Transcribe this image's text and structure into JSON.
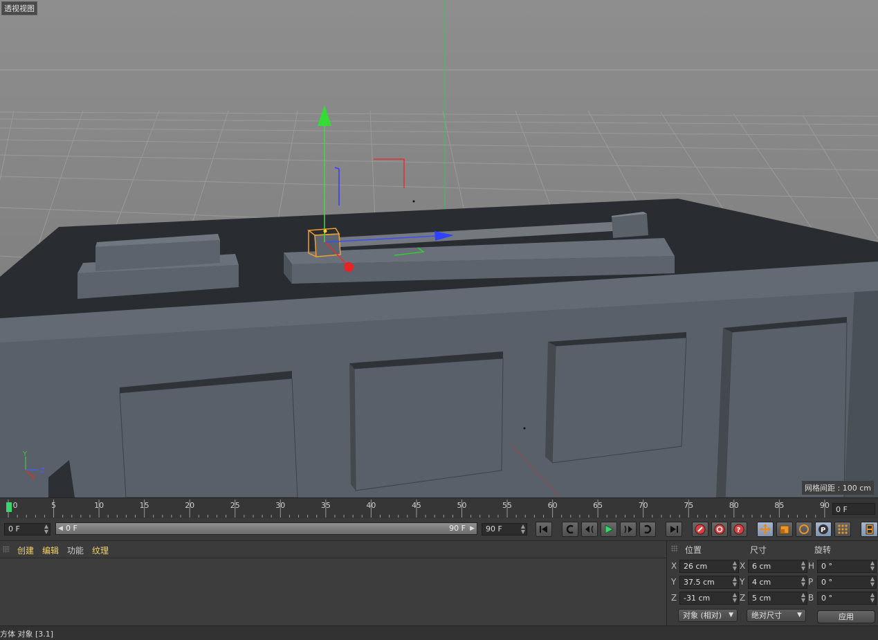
{
  "viewport": {
    "title": "透视视图",
    "grid_spacing_label": "网格间距 : 100 cm",
    "axis_labels": {
      "y": "Y",
      "x": "X",
      "z": "Z"
    }
  },
  "timeline": {
    "ticks": [
      "0",
      "5",
      "10",
      "15",
      "20",
      "25",
      "30",
      "35",
      "40",
      "45",
      "50",
      "55",
      "60",
      "65",
      "70",
      "75",
      "80",
      "85",
      "90"
    ],
    "current_frame": "0 F"
  },
  "transport": {
    "start_field": "0 F",
    "range_start": "0 F",
    "range_end": "90 F",
    "end_field": "90 F",
    "buttons": [
      "go-to-start",
      "previous-key",
      "previous-frame",
      "play",
      "next-frame",
      "next-key",
      "go-to-end",
      "record",
      "autokey",
      "keyframe-help",
      "move-key",
      "scale-key",
      "rotate-key",
      "param-key",
      "point-level",
      "timeline"
    ]
  },
  "object_manager": {
    "menu": [
      "创建",
      "编辑",
      "功能",
      "纹理"
    ]
  },
  "coordinates": {
    "headers": {
      "position": "位置",
      "size": "尺寸",
      "rotation": "旋转"
    },
    "position": [
      {
        "axis": "X",
        "value": "26 cm"
      },
      {
        "axis": "Y",
        "value": "37.5 cm"
      },
      {
        "axis": "Z",
        "value": "-31 cm"
      }
    ],
    "size": [
      {
        "axis": "X",
        "value": "6 cm"
      },
      {
        "axis": "Y",
        "value": "4 cm"
      },
      {
        "axis": "Z",
        "value": "5 cm"
      }
    ],
    "rotation": [
      {
        "axis": "H",
        "value": "0 °"
      },
      {
        "axis": "P",
        "value": "0 °"
      },
      {
        "axis": "B",
        "value": "0 °"
      }
    ],
    "mode_dropdown": "对象 (相对)",
    "size_dropdown": "绝对尺寸",
    "apply_label": "应用"
  },
  "status": {
    "text": "方体 对象 [3.1]"
  },
  "colors": {
    "timeline_cursor": "#3ad36e",
    "highlight_menu": "#f5d36a",
    "selection": "#f0a030"
  }
}
